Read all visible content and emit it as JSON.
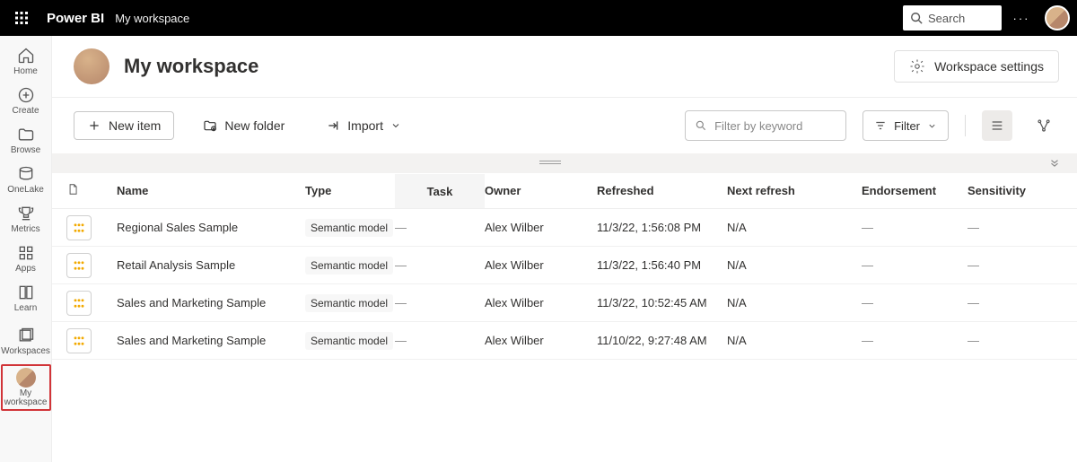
{
  "top": {
    "brand": "Power BI",
    "breadcrumb": "My workspace",
    "search_placeholder": "Search"
  },
  "nav": {
    "home": "Home",
    "create": "Create",
    "browse": "Browse",
    "onelake": "OneLake",
    "metrics": "Metrics",
    "apps": "Apps",
    "learn": "Learn",
    "workspaces": "Workspaces",
    "my_workspace": "My workspace"
  },
  "header": {
    "title": "My workspace",
    "settings_label": "Workspace settings"
  },
  "toolbar": {
    "new_item": "New item",
    "new_folder": "New folder",
    "import": "Import",
    "filter_placeholder": "Filter by keyword",
    "filter_label": "Filter"
  },
  "columns": {
    "name": "Name",
    "type": "Type",
    "task": "Task",
    "owner": "Owner",
    "refreshed": "Refreshed",
    "next_refresh": "Next refresh",
    "endorsement": "Endorsement",
    "sensitivity": "Sensitivity"
  },
  "rows": [
    {
      "name": "Regional Sales Sample",
      "type": "Semantic model",
      "task": "—",
      "owner": "Alex Wilber",
      "refreshed": "11/3/22, 1:56:08 PM",
      "next_refresh": "N/A",
      "endorsement": "—",
      "sensitivity": "—"
    },
    {
      "name": "Retail Analysis Sample",
      "type": "Semantic model",
      "task": "—",
      "owner": "Alex Wilber",
      "refreshed": "11/3/22, 1:56:40 PM",
      "next_refresh": "N/A",
      "endorsement": "—",
      "sensitivity": "—"
    },
    {
      "name": "Sales and Marketing Sample",
      "type": "Semantic model",
      "task": "—",
      "owner": "Alex Wilber",
      "refreshed": "11/3/22, 10:52:45 AM",
      "next_refresh": "N/A",
      "endorsement": "—",
      "sensitivity": "—"
    },
    {
      "name": "Sales and Marketing Sample",
      "type": "Semantic model",
      "task": "—",
      "owner": "Alex Wilber",
      "refreshed": "11/10/22, 9:27:48 AM",
      "next_refresh": "N/A",
      "endorsement": "—",
      "sensitivity": "—"
    }
  ]
}
